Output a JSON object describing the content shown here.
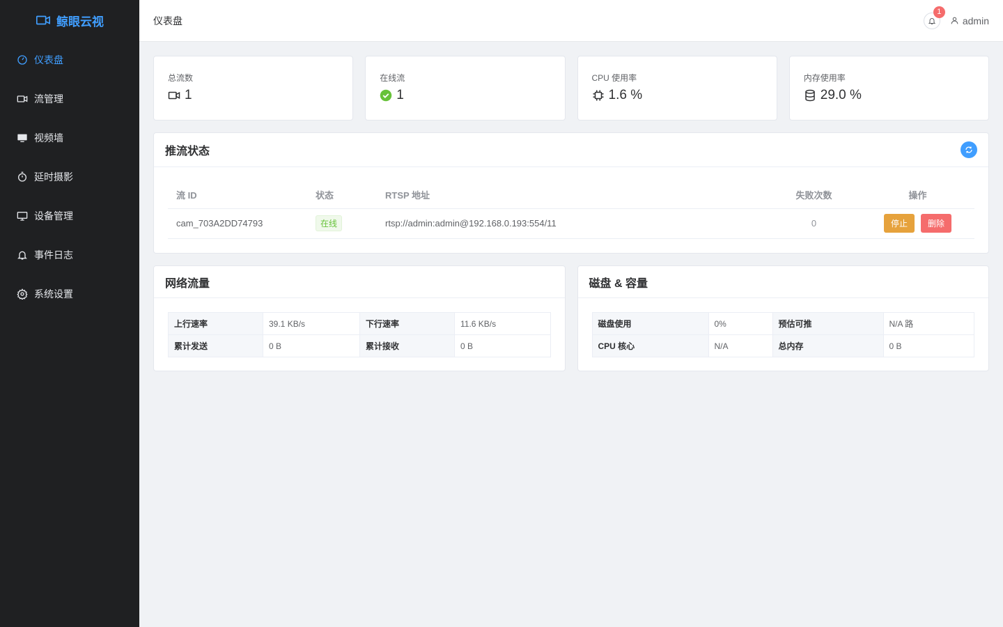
{
  "brand": {
    "name": "鲸眼云视"
  },
  "sidebar": {
    "items": [
      {
        "label": "仪表盘",
        "icon": "dashboard-icon",
        "active": true
      },
      {
        "label": "流管理",
        "icon": "video-camera-icon"
      },
      {
        "label": "视频墙",
        "icon": "monitor-icon"
      },
      {
        "label": "延时摄影",
        "icon": "stopwatch-icon"
      },
      {
        "label": "设备管理",
        "icon": "desktop-icon"
      },
      {
        "label": "事件日志",
        "icon": "bell-icon"
      },
      {
        "label": "系统设置",
        "icon": "gear-icon"
      }
    ]
  },
  "header": {
    "breadcrumb": "仪表盘",
    "notification_count": "1",
    "username": "admin"
  },
  "stats": [
    {
      "label": "总流数",
      "value": "1",
      "icon": "video-camera-icon"
    },
    {
      "label": "在线流",
      "value": "1",
      "icon": "check-circle-icon"
    },
    {
      "label": "CPU 使用率",
      "value": "1.6 %",
      "icon": "cpu-icon"
    },
    {
      "label": "内存使用率",
      "value": "29.0 %",
      "icon": "database-icon"
    }
  ],
  "push_status": {
    "title": "推流状态",
    "columns": [
      "流 ID",
      "状态",
      "RTSP 地址",
      "失败次数",
      "操作"
    ],
    "rows": [
      {
        "stream_id": "cam_703A2DD74793",
        "status": "在线",
        "rtsp": "rtsp://admin:admin@192.168.0.193:554/11",
        "failures": "0",
        "stop_label": "停止",
        "delete_label": "删除"
      }
    ]
  },
  "network": {
    "title": "网络流量",
    "rows": [
      [
        "上行速率",
        "39.1 KB/s",
        "下行速率",
        "11.6 KB/s"
      ],
      [
        "累计发送",
        "0 B",
        "累计接收",
        "0 B"
      ]
    ]
  },
  "disk": {
    "title": "磁盘 & 容量",
    "rows": [
      [
        "磁盘使用",
        "0%",
        "预估可推",
        "N/A 路"
      ],
      [
        "CPU 核心",
        "N/A",
        "总内存",
        "0 B"
      ]
    ]
  },
  "colors": {
    "primary": "#409eff",
    "sidebar_bg": "#1f2022",
    "success": "#67c23a",
    "warning": "#e6a23c",
    "danger": "#f56c6c"
  }
}
